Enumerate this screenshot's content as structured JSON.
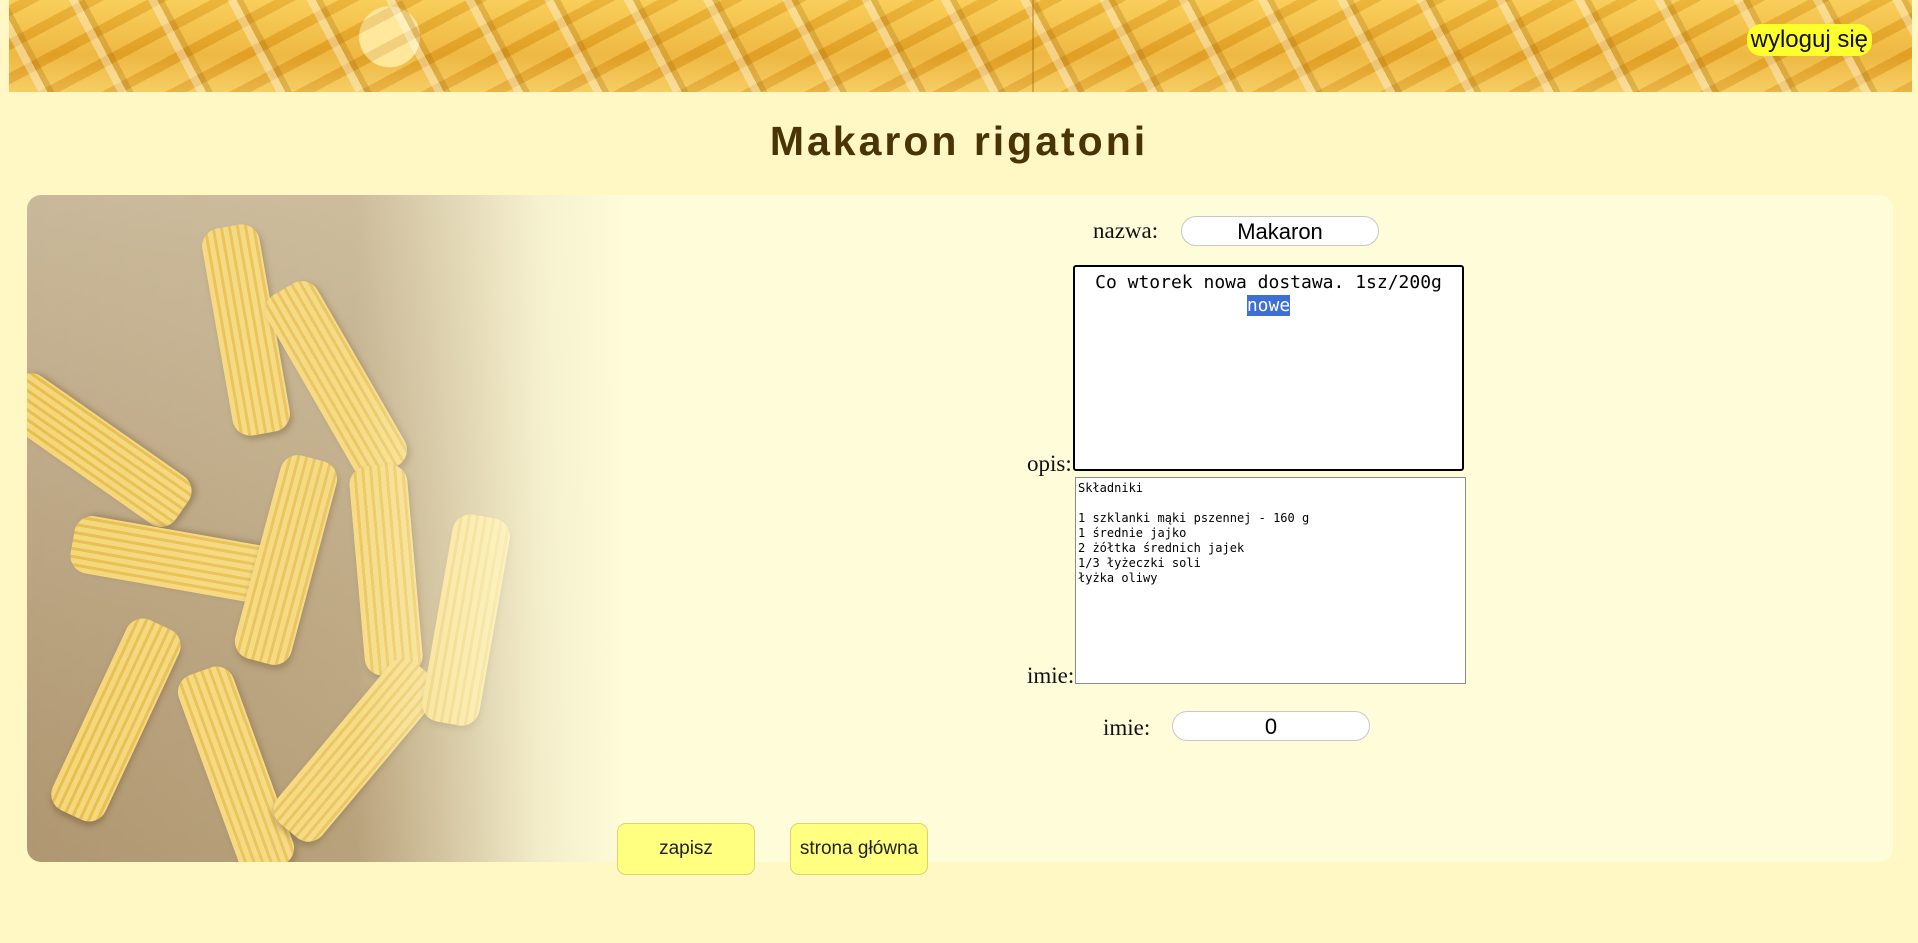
{
  "header": {
    "logout_label": "wyloguj się"
  },
  "page": {
    "title": "Makaron rigatoni"
  },
  "form": {
    "name_label": "nazwa:",
    "name_value": "Makaron",
    "description_label": "opis:",
    "description_text": "Co wtorek nowa dostawa. 1sz/200g",
    "description_selected": "nowe",
    "ingredients_label": "imie:",
    "ingredients_text": "Składniki\n\n1 szklanki mąki pszennej - 160 g\n1 średnie jajko\n2 żółtka średnich jajek\n1/3 łyżeczki soli\nłyżka oliwy",
    "quantity_label": "imie:",
    "quantity_value": "0"
  },
  "actions": {
    "save_label": "zapisz",
    "home_label": "strona główna"
  },
  "colors": {
    "background": "#fff8c4",
    "card": "#fffcda",
    "title": "#4a3405",
    "logout_bg": "#ffff2e",
    "button_bg": "#ffff80",
    "selection": "#3d6fd6"
  }
}
